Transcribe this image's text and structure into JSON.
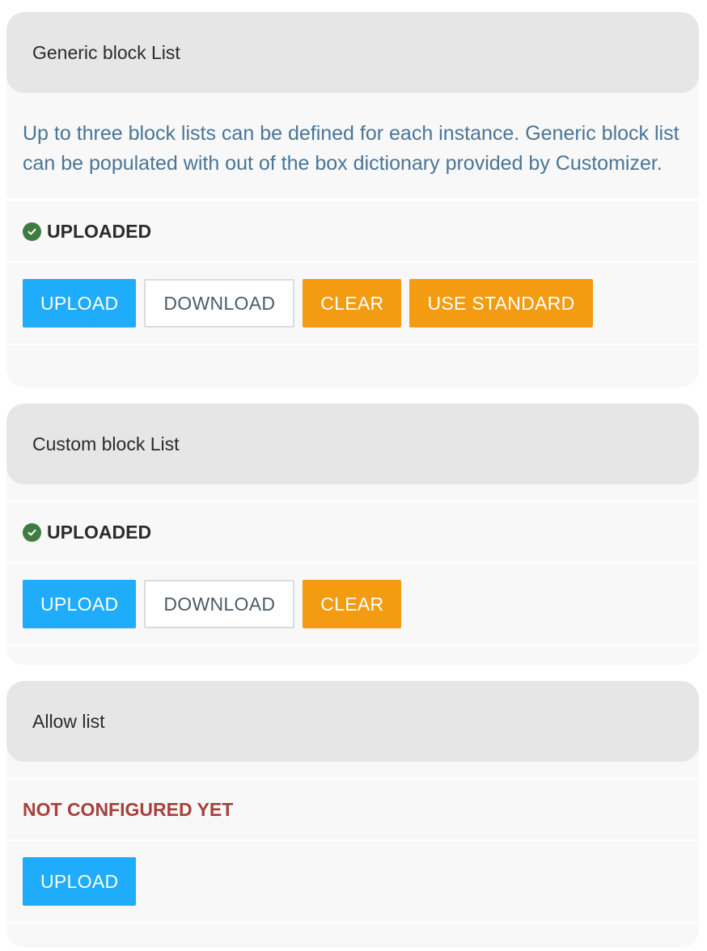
{
  "sections": {
    "generic": {
      "title": "Generic block List",
      "description": "Up to three block lists can be defined for each instance. Generic block list can be populated with out of the box dictionary provided by Customizer.",
      "status": "UPLOADED",
      "buttons": {
        "upload": "UPLOAD",
        "download": "DOWNLOAD",
        "clear": "CLEAR",
        "use_standard": "USE STANDARD"
      }
    },
    "custom": {
      "title": "Custom block List",
      "status": "UPLOADED",
      "buttons": {
        "upload": "UPLOAD",
        "download": "DOWNLOAD",
        "clear": "CLEAR"
      }
    },
    "allow": {
      "title": "Allow list",
      "status": "NOT CONFIGURED YET",
      "buttons": {
        "upload": "UPLOAD"
      }
    }
  },
  "colors": {
    "primary": "#1eacfb",
    "warning": "#f39c12",
    "success": "#3f7c42",
    "error": "#a8403c",
    "description": "#4a7598"
  },
  "icons": {
    "status_ok": "check-circle-icon"
  }
}
